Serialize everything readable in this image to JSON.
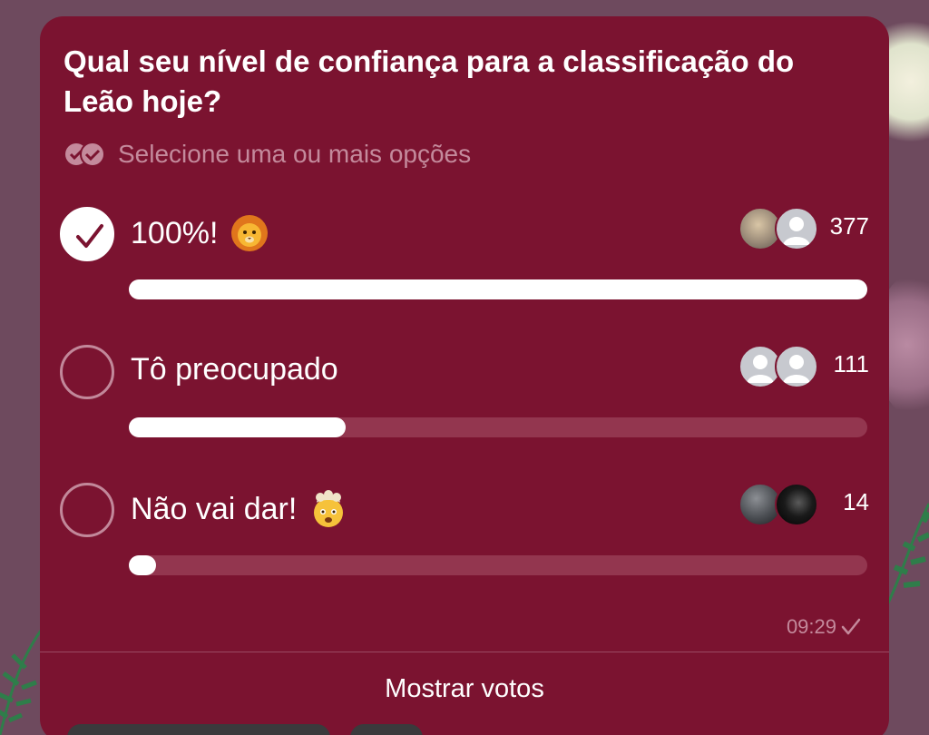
{
  "poll": {
    "question": "Qual seu nível de confiança para a classificação do Leão hoje?",
    "subtitle": "Selecione uma ou mais opções",
    "options": [
      {
        "label": "100%!",
        "emoji": "lion-face",
        "votes": "377",
        "fraction": 1.0,
        "checked": true
      },
      {
        "label": "Tô preocupado",
        "emoji": "",
        "votes": "111",
        "fraction": 0.294,
        "checked": false
      },
      {
        "label": "Não vai dar!",
        "emoji": "exploding-head",
        "votes": "14",
        "fraction": 0.037,
        "checked": false
      }
    ],
    "time": "09:29",
    "show_votes_label": "Mostrar votos"
  },
  "colors": {
    "card": "#7b1330",
    "bar_track": "#93364f",
    "bar_fill": "#ffffff",
    "muted_text": "#c48a9c",
    "background": "#6e4a5e"
  },
  "icons": {
    "subtitle": "multi-check-icon",
    "checked": "checkmark-icon",
    "time_status": "sent-check-icon"
  }
}
